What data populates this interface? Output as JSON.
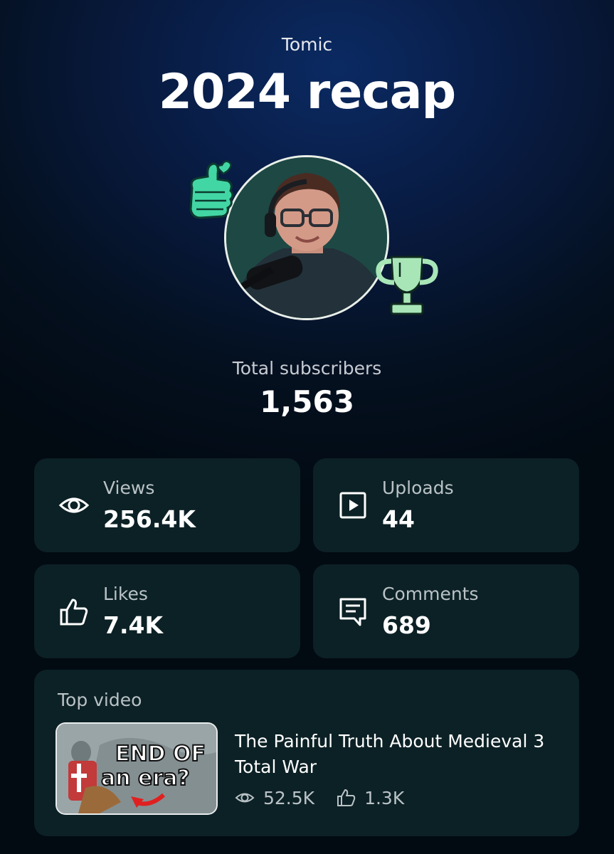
{
  "header": {
    "channel_name": "Tomic",
    "title": "2024 recap"
  },
  "profile": {
    "avatar_icon": "avatar",
    "sticker_left_icon": "thumbs-up-heart-sticker-icon",
    "sticker_right_icon": "trophy-sticker-icon"
  },
  "subscribers": {
    "label": "Total subscribers",
    "value": "1,563"
  },
  "stats": {
    "views": {
      "label": "Views",
      "value": "256.4K",
      "icon": "eye-icon"
    },
    "uploads": {
      "label": "Uploads",
      "value": "44",
      "icon": "play-square-icon"
    },
    "likes": {
      "label": "Likes",
      "value": "7.4K",
      "icon": "thumbs-up-icon"
    },
    "comments": {
      "label": "Comments",
      "value": "689",
      "icon": "comment-icon"
    }
  },
  "top_video": {
    "label": "Top video",
    "title": "The Painful Truth About Medieval 3 Total War",
    "views": "52.5K",
    "likes": "1.3K",
    "thumbnail_text_line1": "END OF",
    "thumbnail_text_line2": "an era?"
  },
  "colors": {
    "card_bg": "#0c2125",
    "sticker_green": "#43d6a5",
    "trophy_green": "#a8e6b8"
  }
}
